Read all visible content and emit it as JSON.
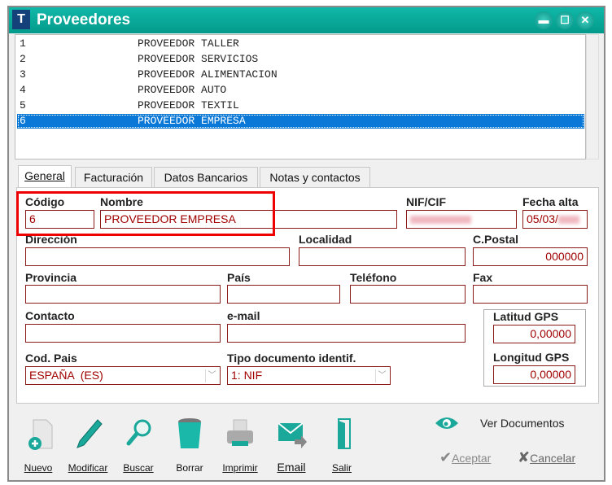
{
  "window": {
    "title": "Proveedores",
    "app_icon": "T",
    "controls": {
      "minimize": "▬",
      "maximize": "☐",
      "close": "✕"
    }
  },
  "list": {
    "rows": [
      {
        "id": "1",
        "name": "PROVEEDOR TALLER"
      },
      {
        "id": "2",
        "name": "PROVEEDOR SERVICIOS"
      },
      {
        "id": "3",
        "name": "PROVEEDOR ALIMENTACION"
      },
      {
        "id": "4",
        "name": "PROVEEDOR AUTO"
      },
      {
        "id": "5",
        "name": "PROVEEDOR TEXTIL"
      },
      {
        "id": "6",
        "name": "PROVEEDOR EMPRESA"
      }
    ],
    "selected_index": 5
  },
  "tabs": [
    {
      "label": "General",
      "active": true
    },
    {
      "label": "Facturación"
    },
    {
      "label": "Datos Bancarios"
    },
    {
      "label": "Notas y contactos"
    }
  ],
  "form": {
    "codigo": {
      "label": "Código",
      "value": "6"
    },
    "nombre": {
      "label": "Nombre",
      "value": "PROVEEDOR EMPRESA"
    },
    "nif": {
      "label": "NIF/CIF",
      "value": ""
    },
    "fecha": {
      "label": "Fecha alta",
      "value": "05/03/"
    },
    "direccion": {
      "label": "Dirección",
      "value": ""
    },
    "localidad": {
      "label": "Localidad",
      "value": ""
    },
    "cpostal": {
      "label": "C.Postal",
      "value": "000000"
    },
    "provincia": {
      "label": "Provincia",
      "value": ""
    },
    "pais": {
      "label": "País",
      "value": ""
    },
    "telefono": {
      "label": "Teléfono",
      "value": ""
    },
    "fax": {
      "label": "Fax",
      "value": ""
    },
    "contacto": {
      "label": "Contacto",
      "value": ""
    },
    "email": {
      "label": "e-mail",
      "value": ""
    },
    "latitud": {
      "label": "Latitud GPS",
      "value": "0,00000"
    },
    "longitud": {
      "label": "Longitud GPS",
      "value": "0,00000"
    },
    "codpais": {
      "label": "Cod. Pais",
      "value": "ESPAÑA  (ES)"
    },
    "tipodoc": {
      "label": "Tipo documento identif.",
      "value": "1: NIF"
    }
  },
  "toolbar": [
    {
      "label": "Nuevo",
      "icon": "new-document-icon"
    },
    {
      "label": "Modificar",
      "icon": "pen-icon"
    },
    {
      "label": "Buscar",
      "icon": "magnifier-icon"
    },
    {
      "label": "Borrar",
      "icon": "trash-icon"
    },
    {
      "label": "Imprimir",
      "icon": "printer-icon"
    },
    {
      "label": "Email",
      "icon": "email-icon"
    },
    {
      "label": "Salir",
      "icon": "door-icon"
    }
  ],
  "actions": {
    "ver_documentos": "Ver Documentos",
    "aceptar": "Aceptar",
    "cancelar": "Cancelar"
  },
  "colors": {
    "title_bar": "#05a99a",
    "selection": "#0a78d7",
    "field_border": "#8b1a1a",
    "field_text": "#a00000",
    "highlight": "#ee0000",
    "icon_teal": "#1aa89a"
  }
}
